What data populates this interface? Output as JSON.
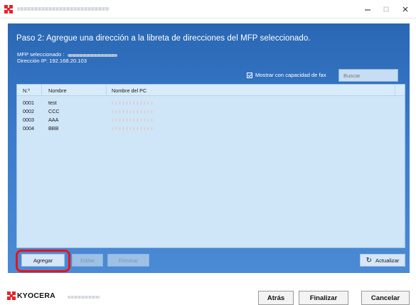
{
  "step_title": "Paso 2: Agregue una dirección a la libreta de direcciones del MFP seleccionado.",
  "mfp_selected_label": "MFP seleccionado :",
  "ip_line": "Dirección IP: 192.168.20.103",
  "fax_checkbox": {
    "label": "Mostrar con capacidad de fax",
    "checked": true
  },
  "search": {
    "placeholder": "Buscar",
    "value": ""
  },
  "table": {
    "headers": [
      "N.º",
      "Nombre",
      "Nombre del PC"
    ],
    "rows": [
      {
        "no": "0001",
        "name": "test"
      },
      {
        "no": "0002",
        "name": "CCC"
      },
      {
        "no": "0003",
        "name": "AAA"
      },
      {
        "no": "0004",
        "name": "BBB"
      }
    ]
  },
  "actions": {
    "add": "Agregar",
    "edit": "Editar",
    "delete": "Eliminar",
    "refresh": "Actualizar"
  },
  "footer": {
    "back": "Atrás",
    "finish": "Finalizar",
    "cancel": "Cancelar"
  },
  "brand": "KYOCERA",
  "colors": {
    "accent": "#2f6fbf",
    "highlight": "#e8141b",
    "brand_red": "#e5242b"
  },
  "icons": {
    "app": "kyocera-logo-icon",
    "refresh": "refresh-icon",
    "checkbox": "check-icon"
  }
}
